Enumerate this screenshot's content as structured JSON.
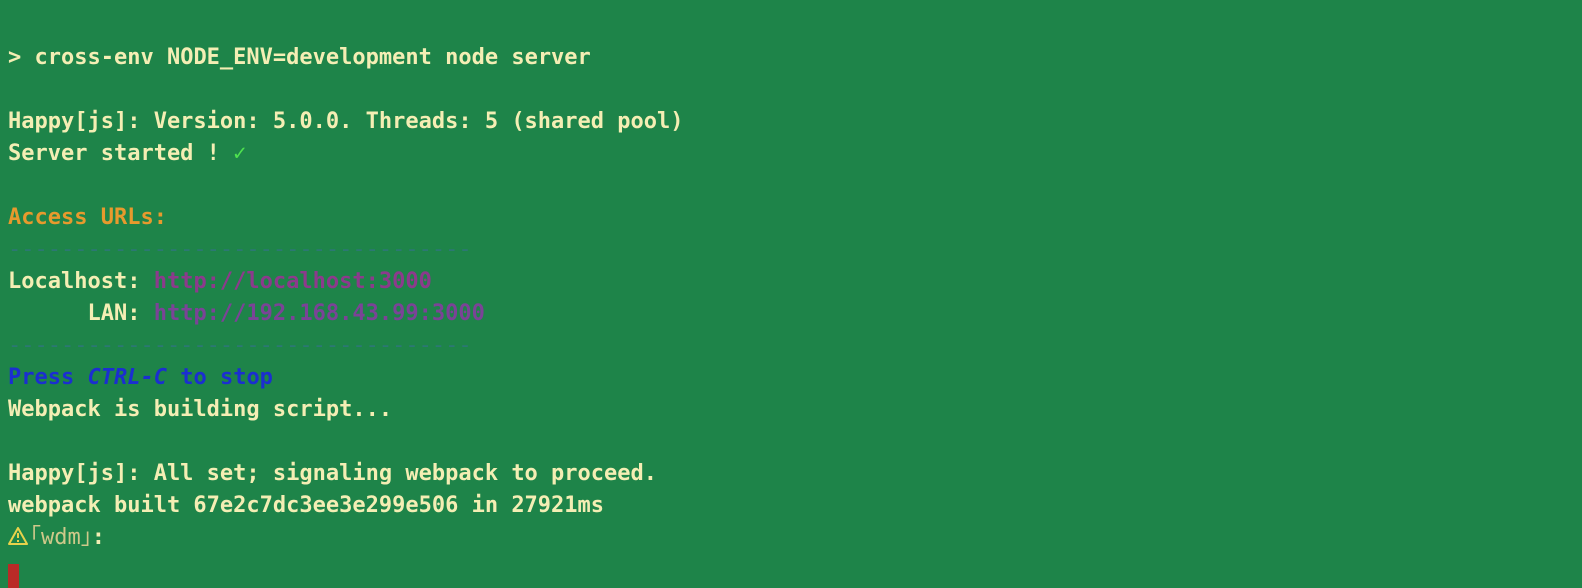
{
  "prompt": "> ",
  "command": "cross-env NODE_ENV=development node server",
  "blank": "",
  "happy_version": "Happy[js]: Version: 5.0.0. Threads: 5 (shared pool)",
  "server_started": "Server started ! ",
  "checkmark": "✓",
  "access_urls_label": "Access URLs:",
  "divider": "-----------------------------------",
  "localhost_label": "Localhost: ",
  "localhost_url": "http://localhost:3000",
  "lan_label": "      LAN: ",
  "lan_url": "http://192.168.43.99:3000",
  "press_prefix": "Press ",
  "ctrl_c": "CTRL-C",
  "press_suffix": " to stop",
  "webpack_building": "Webpack is building script...",
  "happy_allset": "Happy[js]: All set; signaling webpack to proceed.",
  "webpack_built": "webpack built 67e2c7dc3ee3e299e506 in 27921ms",
  "wdm_label": "｢wdm｣",
  "wdm_colon": ": "
}
